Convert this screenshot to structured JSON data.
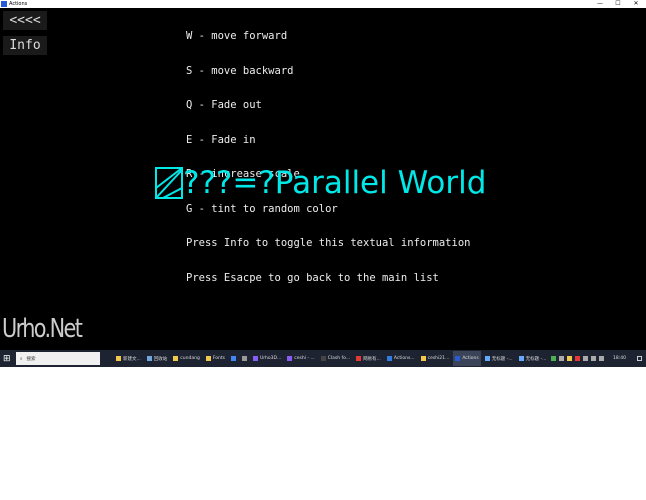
{
  "window": {
    "title": "Actions",
    "controls": [
      "—",
      "☐",
      "✕"
    ]
  },
  "game": {
    "back_button": "<<<<",
    "info_button": "Info",
    "info_lines": [
      "W - move forward",
      "S - move backward",
      "Q - Fade out",
      "E - Fade in",
      "R - increase scale",
      "G - tint to random color",
      "Press Info to toggle this textual information",
      "Press Esacpe to go back to the main list"
    ],
    "title_text": "???=?Parallel World",
    "logo": "UrhoNet",
    "accent": "#00e8e8"
  },
  "taskbar": {
    "search_placeholder": "搜索",
    "items": [
      {
        "label": "新建文...",
        "color": "#f2c94c"
      },
      {
        "label": "回收站",
        "color": "#6fa8dc"
      },
      {
        "label": "cundang",
        "color": "#f2c94c"
      },
      {
        "label": "Fonts",
        "color": "#f2c94c"
      },
      {
        "label": "",
        "color": "#4285f4"
      },
      {
        "label": "",
        "color": "#999999"
      },
      {
        "label": "Urho3D...",
        "color": "#8a5cf6"
      },
      {
        "label": "ceshi - ...",
        "color": "#8a5cf6"
      },
      {
        "label": "Clash fo...",
        "color": "#444444"
      },
      {
        "label": "网易有...",
        "color": "#e53935"
      },
      {
        "label": "Actions...",
        "color": "#2f7de1"
      },
      {
        "label": "ceshi21...",
        "color": "#f2c94c"
      },
      {
        "label": "Actions",
        "color": "#2a5bd7",
        "active": true
      },
      {
        "label": "无标题 -...",
        "color": "#66aaff"
      },
      {
        "label": "无标题 -...",
        "color": "#66aaff"
      }
    ],
    "clock": "18:40"
  }
}
